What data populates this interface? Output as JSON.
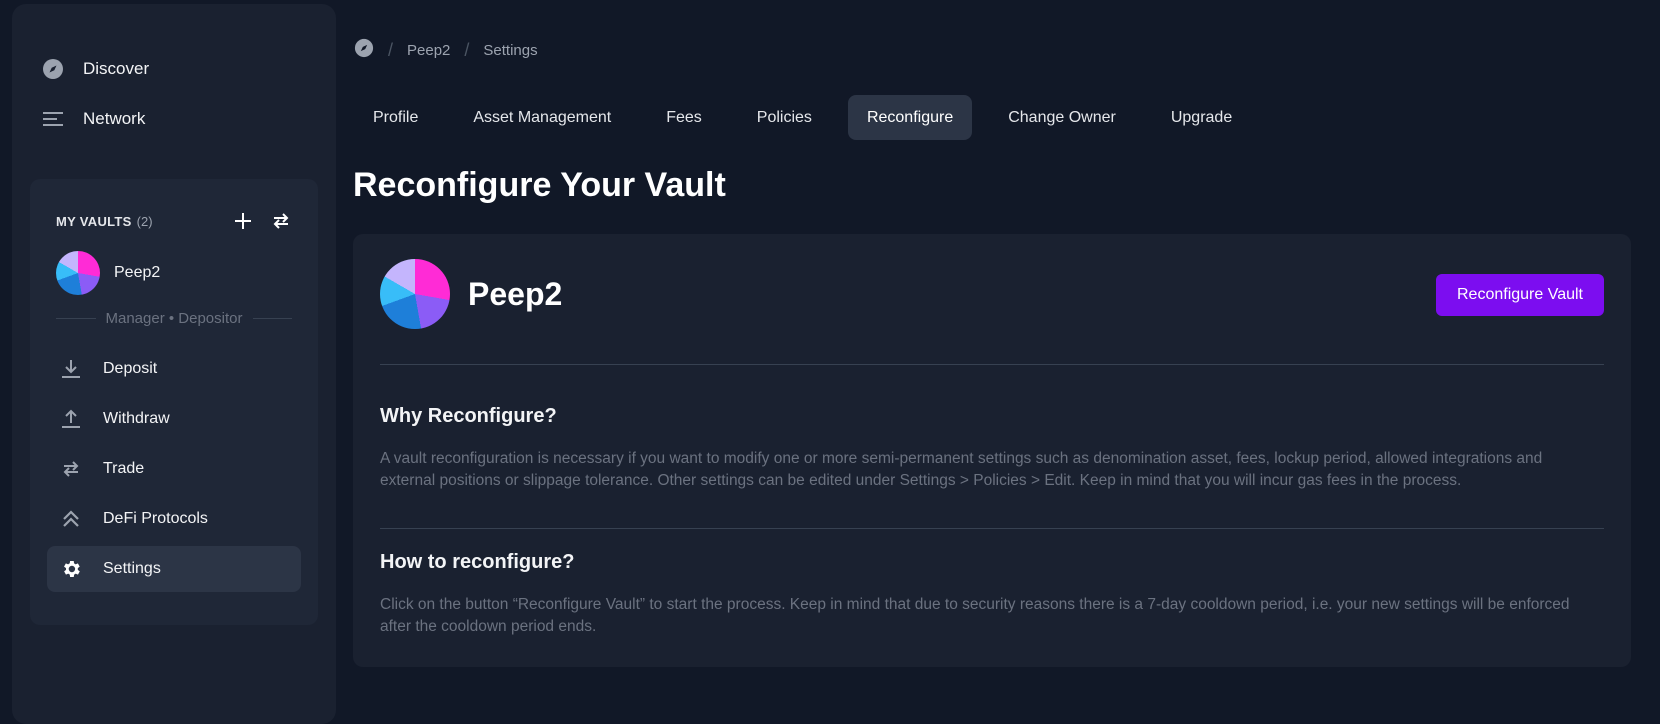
{
  "nav": {
    "items": [
      {
        "label": "Discover",
        "icon": "compass-icon"
      },
      {
        "label": "Network",
        "icon": "network-icon"
      }
    ]
  },
  "vaults": {
    "title": "MY VAULTS",
    "count": "(2)",
    "current": {
      "name": "Peep2",
      "roles": "Manager • Depositor"
    },
    "menu": [
      {
        "label": "Deposit",
        "icon": "download-icon"
      },
      {
        "label": "Withdraw",
        "icon": "upload-icon"
      },
      {
        "label": "Trade",
        "icon": "swap-icon"
      },
      {
        "label": "DeFi Protocols",
        "icon": "chevrons-up-icon"
      },
      {
        "label": "Settings",
        "icon": "gear-icon",
        "active": true
      }
    ]
  },
  "breadcrumb": {
    "items": [
      "Peep2",
      "Settings"
    ]
  },
  "tabs": [
    {
      "label": "Profile"
    },
    {
      "label": "Asset Management"
    },
    {
      "label": "Fees"
    },
    {
      "label": "Policies"
    },
    {
      "label": "Reconfigure",
      "active": true
    },
    {
      "label": "Change Owner"
    },
    {
      "label": "Upgrade"
    }
  ],
  "page": {
    "title": "Reconfigure Your Vault",
    "vault_name": "Peep2",
    "button": "Reconfigure Vault",
    "why_title": "Why Reconfigure?",
    "why_text": "A vault reconfiguration is necessary if you want to modify one or more semi-permanent settings such as denomination asset, fees, lockup period, allowed integrations and external positions or slippage tolerance. Other settings can be edited under Settings > Policies > Edit. Keep in mind that you will incur gas fees in the process.",
    "how_title": "How to reconfigure?",
    "how_text": "Click on the button “Reconfigure Vault” to start the process. Keep in mind that due to security reasons there is a 7-day cooldown period, i.e. your new settings will be enforced after the cooldown period ends."
  },
  "colors": {
    "accent": "#7c0df0",
    "background": "#111827",
    "panel": "#1a2130"
  }
}
